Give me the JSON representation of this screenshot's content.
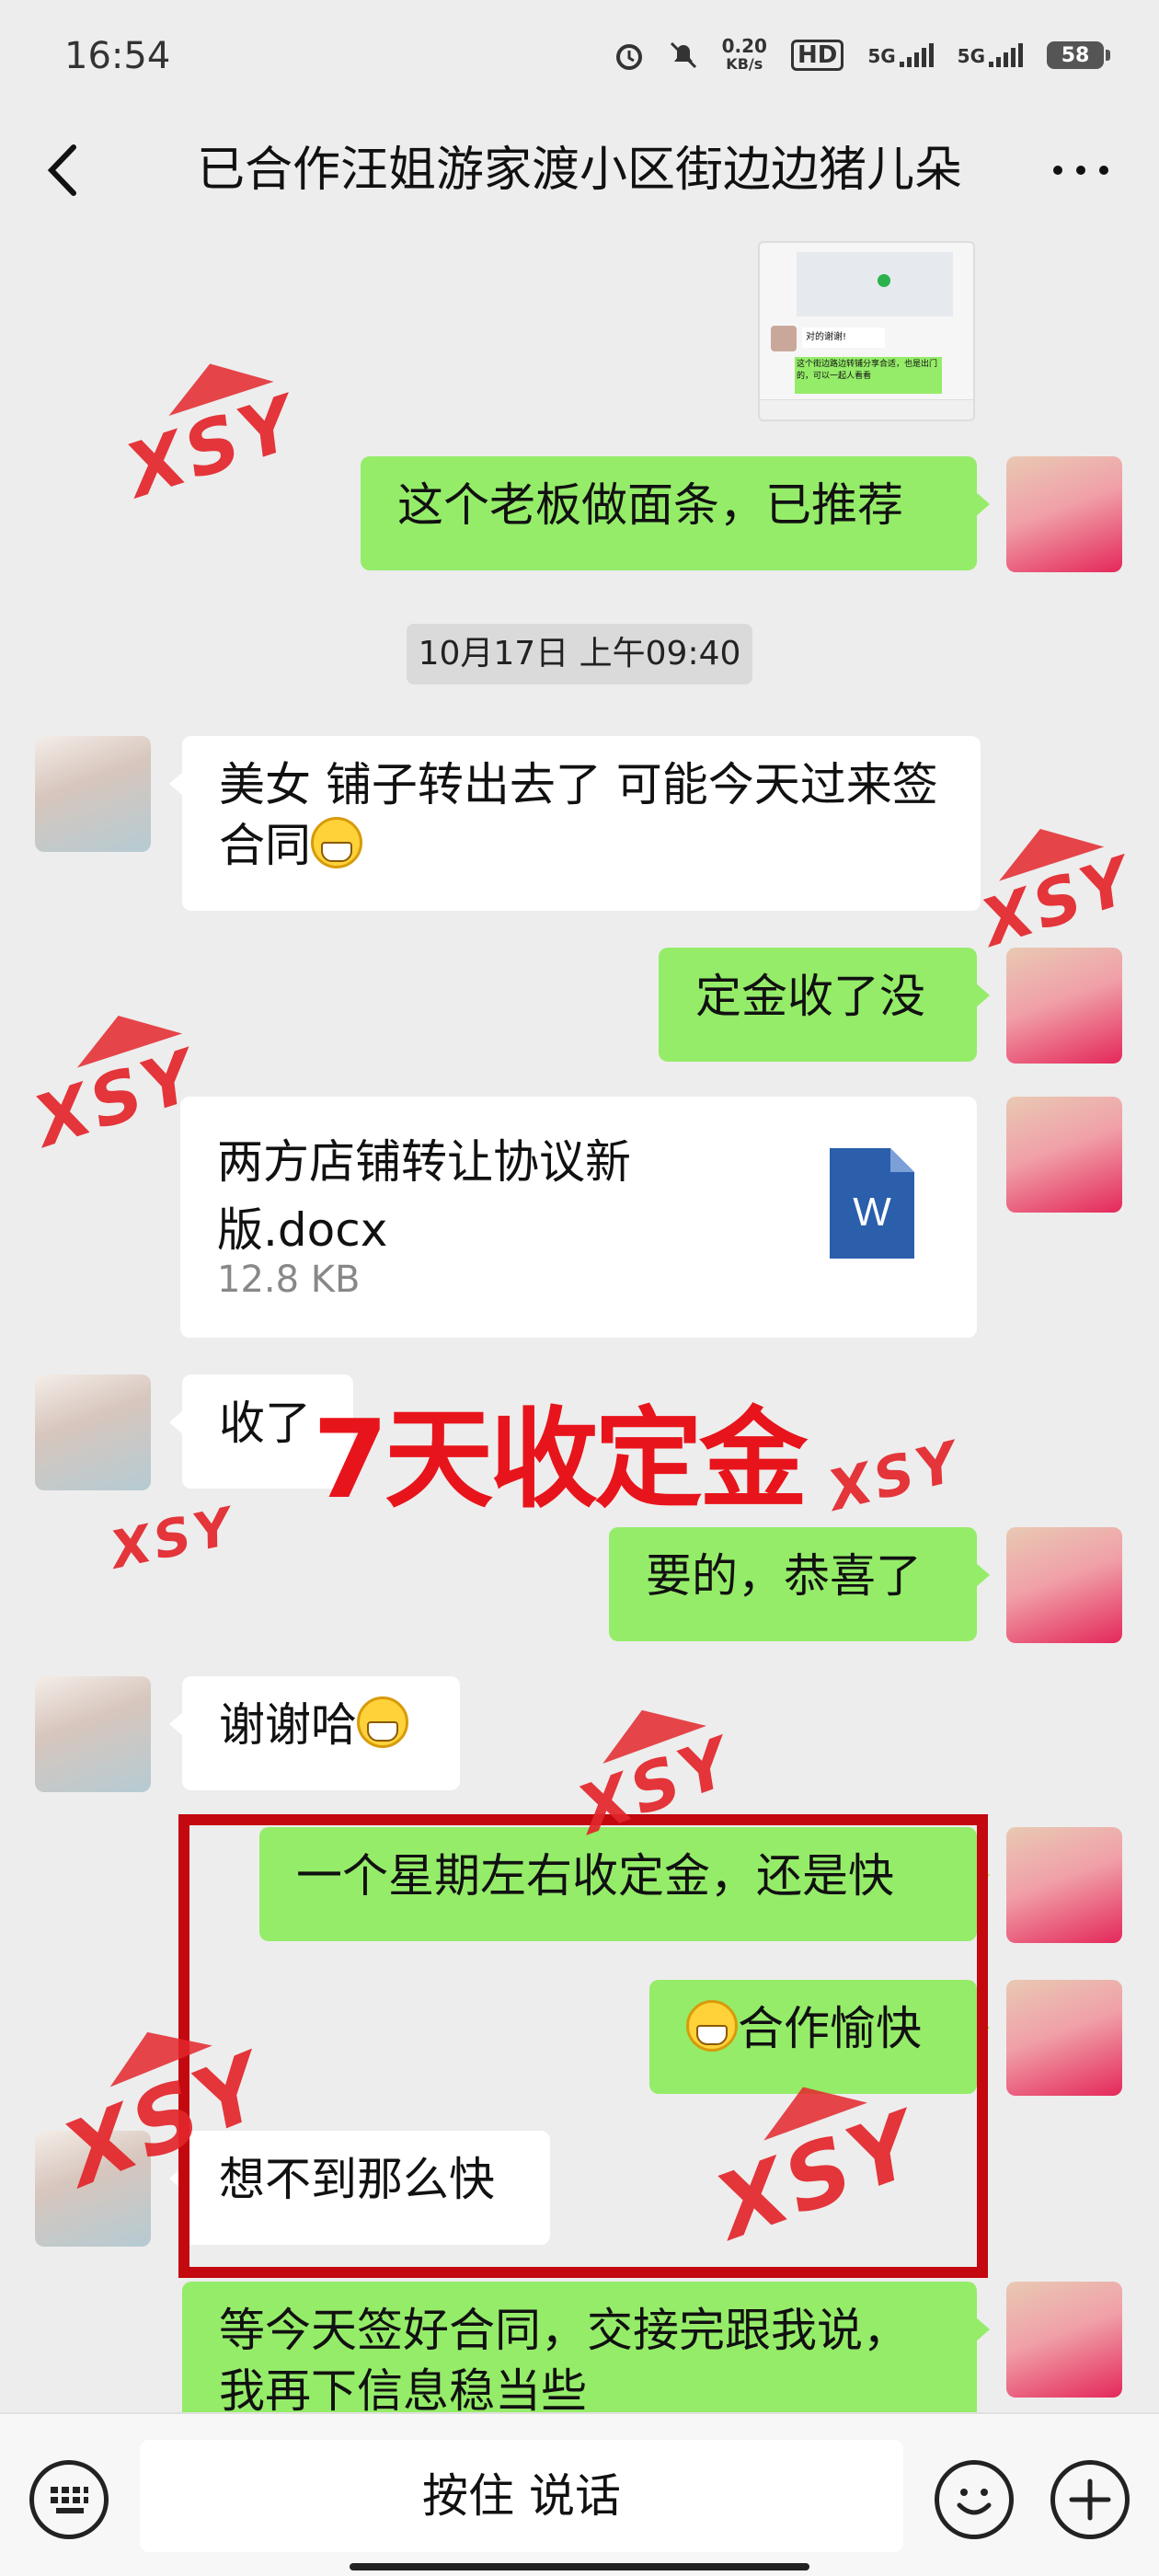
{
  "status": {
    "time": "16:54",
    "speed_value": "0.20",
    "speed_unit": "KB/s",
    "hd": "HD",
    "net1": "5G",
    "net2": "5G",
    "battery": "58"
  },
  "header": {
    "title": "已合作汪姐游家渡小区街边边猪儿朵"
  },
  "messages": [
    {
      "side": "right",
      "text": "这个老板做面条，已推荐"
    },
    {
      "timestamp": "10月17日 上午09:40"
    },
    {
      "side": "left",
      "text": "美女 铺子转出去了 可能今天过来签合同"
    },
    {
      "side": "right",
      "text": "定金收了没"
    },
    {
      "side": "right",
      "file_name": "两方店铺转让协议新版.docx",
      "file_size": "12.8 KB",
      "file_icon_letter": "W"
    },
    {
      "side": "left",
      "text": "收了"
    },
    {
      "side": "right",
      "text": "要的，恭喜了"
    },
    {
      "side": "left",
      "text": "谢谢哈"
    },
    {
      "side": "right",
      "text": "一个星期左右收定金，还是快"
    },
    {
      "side": "right",
      "text": "合作愉快"
    },
    {
      "side": "left",
      "text": "想不到那么快"
    },
    {
      "side": "right",
      "text": "等今天签好合同，交接完跟我说，我再下信息稳当些"
    }
  ],
  "overlay": {
    "headline": "7天收定金",
    "watermark": "XSY"
  },
  "thumbnail": {
    "line1": "对的谢谢!",
    "line2": "这个街边路边转铺分享合适，也是出门的，可以一起人看看"
  },
  "bottom": {
    "voice_label": "按住 说话"
  },
  "colors": {
    "sent_bubble": "#95ec69",
    "received_bubble": "#ffffff",
    "background": "#ededed",
    "accent_red": "#e8141b"
  }
}
